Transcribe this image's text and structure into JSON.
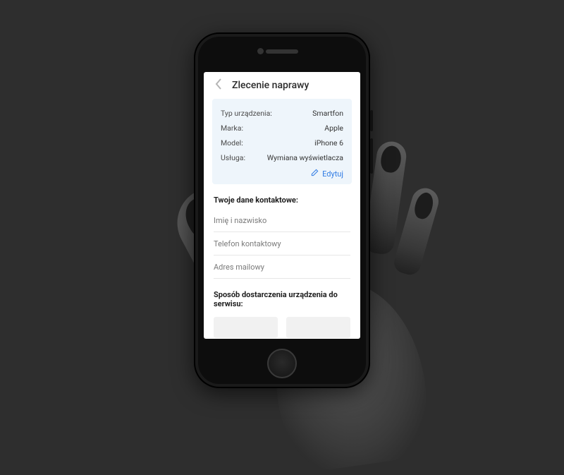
{
  "header": {
    "title": "Zlecenie naprawy"
  },
  "summary": {
    "rows": [
      {
        "label": "Typ urządzenia:",
        "value": "Smartfon"
      },
      {
        "label": "Marka:",
        "value": "Apple"
      },
      {
        "label": "Model:",
        "value": "iPhone 6"
      },
      {
        "label": "Usługa:",
        "value": "Wymiana wyświetlacza"
      }
    ],
    "edit_label": "Edytuj"
  },
  "contact": {
    "heading": "Twoje dane kontaktowe:",
    "fields": [
      {
        "placeholder": "Imię i nazwisko"
      },
      {
        "placeholder": "Telefon kontaktowy"
      },
      {
        "placeholder": "Adres mailowy"
      }
    ]
  },
  "delivery": {
    "heading": "Sposób dostarczenia urządzenia do serwisu:"
  }
}
